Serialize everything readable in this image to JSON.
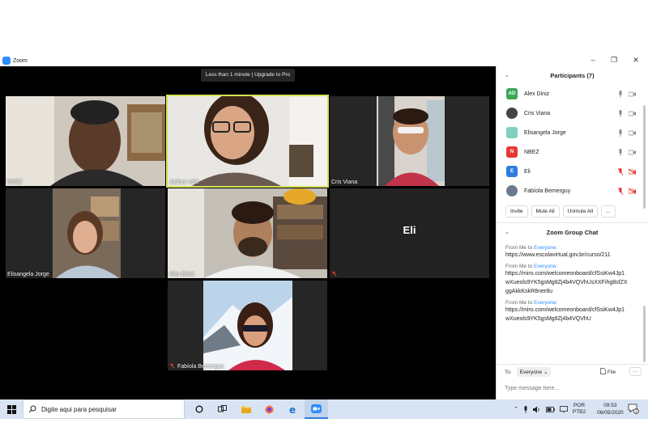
{
  "window": {
    "title": "Zoom",
    "controls": {
      "minimize": "–",
      "maximize": "❐",
      "close": "✕"
    }
  },
  "banner": {
    "text": "Less than 1 minute | Upgrade to Pro"
  },
  "tiles": [
    {
      "name": "NBEZ"
    },
    {
      "name": "Jadora Vale"
    },
    {
      "name": "Cris Viana"
    },
    {
      "name": "Elisangela Jorge"
    },
    {
      "name": "Alex Diniz"
    },
    {
      "name": "Eli",
      "big_label": "Eli"
    },
    {
      "name": "Fabíola Bemerguy"
    }
  ],
  "participants_panel": {
    "title": "Participants (7)",
    "participants": [
      {
        "initials": "AD",
        "name": "Alex Diniz",
        "color": "#3aa757",
        "muted": false
      },
      {
        "initials": "",
        "name": "Cris Viana",
        "color": "#444444",
        "muted": false
      },
      {
        "initials": "",
        "name": "Elisangela Jorge",
        "color": "#7fd0c0",
        "muted": false
      },
      {
        "initials": "N",
        "name": "NBEZ",
        "color": "#e53935",
        "muted": false
      },
      {
        "initials": "E",
        "name": "Eli",
        "color": "#2d7de0",
        "muted": true
      },
      {
        "initials": "",
        "name": "Fabíola Bemerguy",
        "color": "#6b7b8c",
        "muted": true
      }
    ],
    "buttons": {
      "invite": "Invite",
      "mute_all": "Mute All",
      "unmute_all": "Unmute All",
      "more": "..."
    }
  },
  "chat_panel": {
    "title": "Zoom Group Chat",
    "messages": [
      {
        "from": "From Me to ",
        "to": "Everyone:",
        "text": "https://www.escolavirtual.gov.br/curso/211"
      },
      {
        "from": "From Me to ",
        "to": "Everyone:",
        "text": "https://miro.com/welcomeonboard/cfSsiKw4Jp1wXueols9YK5gsMg8Zj4b4VQVhUsXXFihg8sfZXggAkkKskR8ner8u"
      },
      {
        "from": "From Me to ",
        "to": "Everyone:",
        "text": "https://miro.com/welcomeonboard/cfSsiKw4Jp1wXueols9YK5gsMg8Zj4b4VQVhU"
      }
    ],
    "to_label": "To:",
    "to_value": "Everyone ⌄",
    "file_label": "File",
    "more_label": "···",
    "input_placeholder": "Type message here..."
  },
  "taskbar": {
    "search_placeholder": "Digite aqui para pesquisar",
    "lang_top": "POR",
    "lang_bottom": "PTB2",
    "time": "09:53",
    "date": "06/05/2020",
    "notifications": "3"
  },
  "colors": {
    "accent": "#2d8cff",
    "active_speaker": "#d4e157",
    "muted_red": "#e53935"
  }
}
